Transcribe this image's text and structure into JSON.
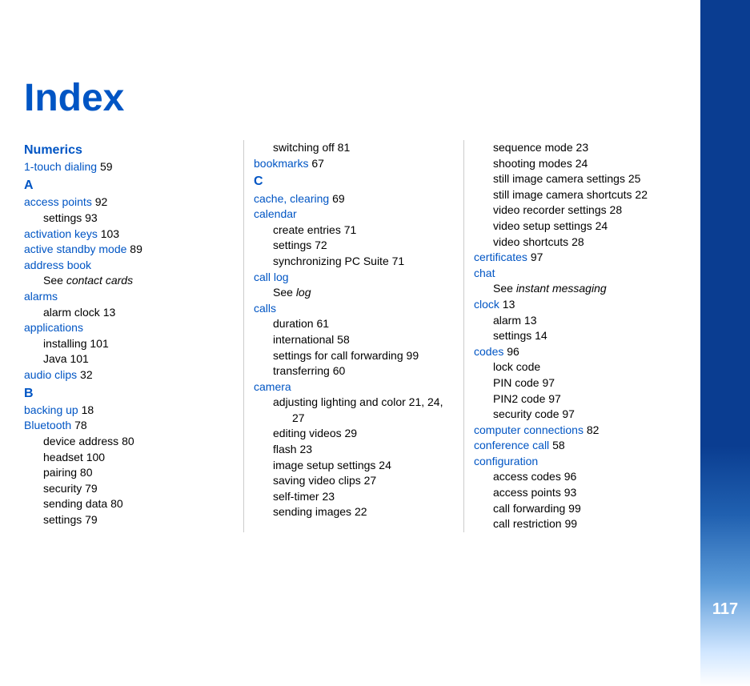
{
  "title": "Index",
  "page_number": "117",
  "col1": {
    "letter_num": "Numerics",
    "e0": {
      "topic": "1-touch dialing",
      "pg": "59"
    },
    "letter_a": "A",
    "e1": {
      "topic": "access points",
      "pg": "92"
    },
    "e1a": {
      "sub": "settings",
      "pg": "93"
    },
    "e2": {
      "topic": "activation keys",
      "pg": "103"
    },
    "e3": {
      "topic": "active standby mode",
      "pg": "89"
    },
    "e4": {
      "topic": "address book"
    },
    "e4a": {
      "see_prefix": "See ",
      "see": "contact cards"
    },
    "e5": {
      "topic": "alarms"
    },
    "e5a": {
      "sub": "alarm clock",
      "pg": "13"
    },
    "e6": {
      "topic": "applications"
    },
    "e6a": {
      "sub": "installing",
      "pg": "101"
    },
    "e6b": {
      "sub": "Java",
      "pg": "101"
    },
    "e7": {
      "topic": "audio clips",
      "pg": "32"
    },
    "letter_b": "B",
    "e8": {
      "topic": "backing up",
      "pg": "18"
    },
    "e9": {
      "topic": "Bluetooth",
      "pg": "78"
    },
    "e9a": {
      "sub": "device address",
      "pg": "80"
    },
    "e9b": {
      "sub": "headset",
      "pg": "100"
    },
    "e9c": {
      "sub": "pairing",
      "pg": "80"
    },
    "e9d": {
      "sub": "security",
      "pg": "79"
    },
    "e9e": {
      "sub": "sending data",
      "pg": "80"
    },
    "e9f": {
      "sub": "settings",
      "pg": "79"
    }
  },
  "col2": {
    "e0": {
      "sub": "switching off",
      "pg": "81"
    },
    "e1": {
      "topic": "bookmarks",
      "pg": "67"
    },
    "letter_c": "C",
    "e2": {
      "topic": "cache, clearing",
      "pg": "69"
    },
    "e3": {
      "topic": "calendar"
    },
    "e3a": {
      "sub": "create entries",
      "pg": "71"
    },
    "e3b": {
      "sub": "settings",
      "pg": "72"
    },
    "e3c": {
      "sub": "synchronizing PC Suite",
      "pg": "71"
    },
    "e4": {
      "topic": "call log"
    },
    "e4a": {
      "see_prefix": "See ",
      "see": "log"
    },
    "e5": {
      "topic": "calls"
    },
    "e5a": {
      "sub": "duration",
      "pg": "61"
    },
    "e5b": {
      "sub": "international",
      "pg": "58"
    },
    "e5c": {
      "sub": "settings for call forwarding",
      "pg": "99"
    },
    "e5d": {
      "sub": "transferring",
      "pg": "60"
    },
    "e6": {
      "topic": "camera"
    },
    "e6a": {
      "sub": "adjusting lighting and color",
      "pg": "21, 24,"
    },
    "e6a2": {
      "pg": "27"
    },
    "e6b": {
      "sub": "editing videos",
      "pg": "29"
    },
    "e6c": {
      "sub": "flash",
      "pg": "23"
    },
    "e6d": {
      "sub": "image setup settings",
      "pg": "24"
    },
    "e6e": {
      "sub": "saving video clips",
      "pg": "27"
    },
    "e6f": {
      "sub": "self-timer",
      "pg": "23"
    },
    "e6g": {
      "sub": "sending images",
      "pg": "22"
    }
  },
  "col3": {
    "e0a": {
      "sub": "sequence mode",
      "pg": "23"
    },
    "e0b": {
      "sub": "shooting modes",
      "pg": "24"
    },
    "e0c": {
      "sub": "still image camera settings",
      "pg": "25"
    },
    "e0d": {
      "sub": "still image camera shortcuts",
      "pg": "22"
    },
    "e0e": {
      "sub": "video recorder settings",
      "pg": "28"
    },
    "e0f": {
      "sub": "video setup settings",
      "pg": "24"
    },
    "e0g": {
      "sub": "video shortcuts",
      "pg": "28"
    },
    "e1": {
      "topic": "certificates",
      "pg": "97"
    },
    "e2": {
      "topic": "chat"
    },
    "e2a": {
      "see_prefix": "See ",
      "see": "instant messaging"
    },
    "e3": {
      "topic": "clock",
      "pg": "13"
    },
    "e3a": {
      "sub": "alarm",
      "pg": "13"
    },
    "e3b": {
      "sub": "settings",
      "pg": "14"
    },
    "e4": {
      "topic": "codes",
      "pg": "96"
    },
    "e4a": {
      "sub": "lock code"
    },
    "e4b": {
      "sub": "PIN code",
      "pg": "97"
    },
    "e4c": {
      "sub": "PIN2 code",
      "pg": "97"
    },
    "e4d": {
      "sub": "security code",
      "pg": "97"
    },
    "e5": {
      "topic": "computer connections",
      "pg": "82"
    },
    "e6": {
      "topic": "conference call",
      "pg": "58"
    },
    "e7": {
      "topic": "configuration"
    },
    "e7a": {
      "sub": "access codes",
      "pg": "96"
    },
    "e7b": {
      "sub": "access points",
      "pg": "93"
    },
    "e7c": {
      "sub": "call forwarding",
      "pg": "99"
    },
    "e7d": {
      "sub": "call restriction",
      "pg": "99"
    }
  }
}
